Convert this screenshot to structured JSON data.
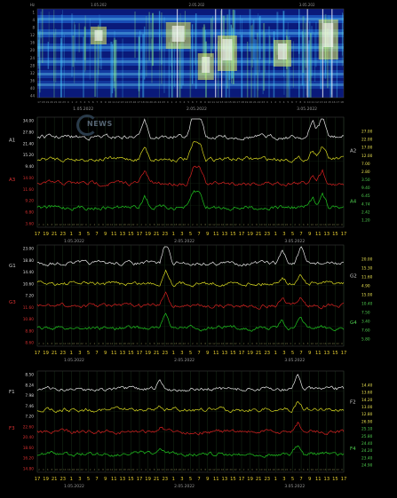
{
  "logo": {
    "text": "NEWS"
  },
  "chart_data": [
    {
      "type": "heatmap",
      "y_ticks": [
        "1",
        "4",
        "8",
        "12",
        "16",
        "20",
        "24",
        "28",
        "32",
        "36",
        "40",
        "44"
      ],
      "y_unit": "Hz",
      "top_dates": [
        "1.05.202",
        "2.05.202",
        "3.05.202"
      ],
      "dates": [
        "1.05.2022",
        "2.05.2022",
        "3.05.2022"
      ]
    },
    {
      "type": "line",
      "series_labels": [
        "A1",
        "A3",
        "A2",
        "A4"
      ],
      "left_ticks": [
        "34.00",
        "27.80",
        "21.40",
        "15.20",
        "9.40",
        "14.00",
        "11.60",
        "9.20",
        "6.80",
        "3.60"
      ],
      "right_ticks": [
        "27.00",
        "22.00",
        "17.00",
        "12.00",
        "7.00",
        "2.80",
        "3.50",
        "9.40",
        "6.45",
        "4.74",
        "2.42",
        "1.20"
      ],
      "x_ticks": [
        "17",
        "19",
        "21",
        "23",
        "1",
        "3",
        "5",
        "7",
        "9",
        "11",
        "13",
        "15",
        "17",
        "19",
        "21",
        "23",
        "1",
        "3",
        "5",
        "7",
        "9",
        "11",
        "13",
        "15",
        "17",
        "19",
        "21",
        "23",
        "1",
        "3",
        "5",
        "7",
        "9",
        "11",
        "13",
        "15",
        "17"
      ],
      "dates": [
        "1.05.2022",
        "2.05.2022",
        "3.05.2022"
      ]
    },
    {
      "type": "line",
      "series_labels": [
        "G1",
        "G3",
        "G2",
        "G4"
      ],
      "left_ticks": [
        "23.00",
        "18.80",
        "14.40",
        "10.60",
        "7.20",
        "11.60",
        "10.80",
        "8.80",
        "8.60"
      ],
      "right_ticks": [
        "20.00",
        "15.30",
        "11.60",
        "4.90",
        "15.00",
        "10.40",
        "7.50",
        "3.40",
        "7.60",
        "5.80"
      ],
      "x_ticks": [
        "17",
        "19",
        "21",
        "23",
        "1",
        "3",
        "5",
        "7",
        "9",
        "11",
        "13",
        "15",
        "17",
        "19",
        "21",
        "23",
        "1",
        "3",
        "5",
        "7",
        "9",
        "11",
        "13",
        "15",
        "17",
        "19",
        "21",
        "23",
        "1",
        "3",
        "5",
        "7",
        "9",
        "11",
        "13",
        "15",
        "17"
      ],
      "dates": [
        "1.05.2022",
        "2.05.2022",
        "3.05.2022"
      ]
    },
    {
      "type": "line",
      "series_labels": [
        "F1",
        "F3",
        "F2",
        "F4"
      ],
      "left_ticks": [
        "8.50",
        "8.24",
        "7.98",
        "7.46",
        "7.20",
        "22.60",
        "20.40",
        "18.60",
        "16.20",
        "14.80"
      ],
      "right_ticks": [
        "14.40",
        "13.60",
        "14.20",
        "13.00",
        "12.80",
        "26.90",
        "25.10",
        "25.80",
        "24.40",
        "24.20",
        "23.40",
        "24.90"
      ],
      "x_ticks": [
        "17",
        "19",
        "21",
        "23",
        "1",
        "3",
        "5",
        "7",
        "9",
        "11",
        "13",
        "15",
        "17",
        "19",
        "21",
        "23",
        "1",
        "3",
        "5",
        "7",
        "9",
        "11",
        "13",
        "15",
        "17",
        "19",
        "21",
        "23",
        "1",
        "3",
        "5",
        "7",
        "9",
        "11",
        "13",
        "15",
        "17"
      ],
      "dates": [
        "1.05.2022",
        "2.05.2022",
        "3.05.2022"
      ]
    }
  ]
}
